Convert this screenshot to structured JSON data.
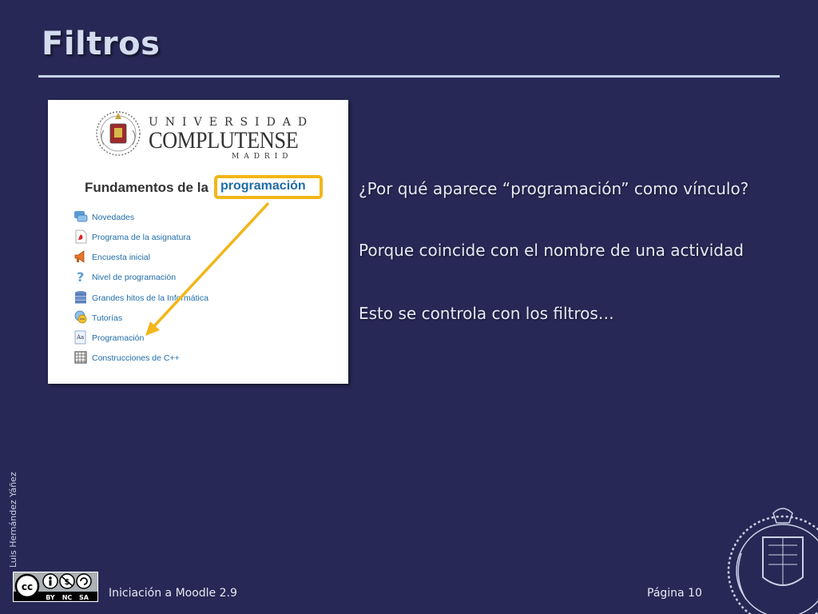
{
  "slide": {
    "title": "Filtros"
  },
  "screenshot": {
    "university_line1": "UNIVERSIDAD",
    "university_line2": "COMPLUTENSE",
    "university_line3": "MADRID",
    "course_title": "Fundamentos de la",
    "highlighted_link": "programación",
    "activities": [
      {
        "label": "Novedades",
        "icon": "forum-icon"
      },
      {
        "label": "Programa de la asignatura",
        "icon": "pdf-icon"
      },
      {
        "label": "Encuesta inicial",
        "icon": "survey-icon"
      },
      {
        "label": "Nivel de programación",
        "icon": "question-icon"
      },
      {
        "label": "Grandes hitos de la Informática",
        "icon": "database-icon"
      },
      {
        "label": "Tutorías",
        "icon": "chat-icon"
      },
      {
        "label": "Programación",
        "icon": "glossary-icon"
      },
      {
        "label": "Construcciones de C++",
        "icon": "workshop-icon"
      }
    ],
    "highlight_color": "#f2b619",
    "link_color": "#1f6ca8"
  },
  "content": {
    "question": "¿Por qué aparece “programación” como vínculo?",
    "answer": "Porque coincide con el nombre de una actividad",
    "note": "Esto se controla con los filtros…"
  },
  "footer": {
    "author": "Luis Hernández Yáñez",
    "course": "Iniciación a Moodle 2.9",
    "page": "Página 10",
    "license": {
      "cc": "cc",
      "by": "BY",
      "nc": "NC",
      "sa": "SA"
    }
  },
  "colors": {
    "background": "#282856",
    "title": "#d3dcef",
    "text": "#e5e9f3"
  }
}
